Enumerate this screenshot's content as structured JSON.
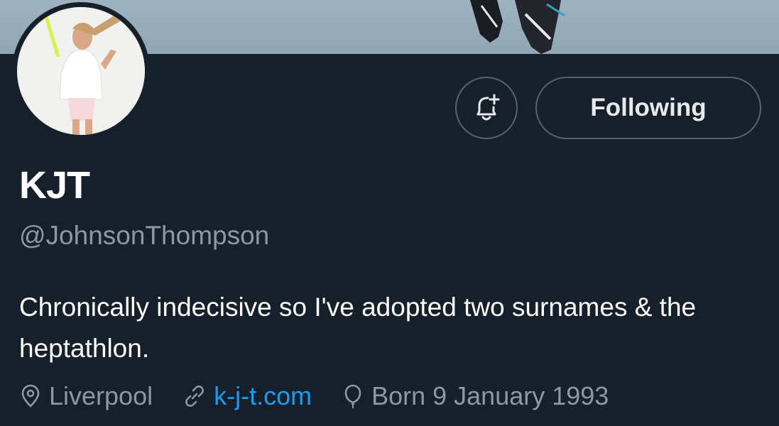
{
  "profile": {
    "display_name": "KJT",
    "handle": "@JohnsonThompson",
    "bio": "Chronically indecisive so I've adopted two surnames & the heptathlon.",
    "location": "Liverpool",
    "website": "k-j-t.com",
    "birthday": "Born 9 January 1993"
  },
  "actions": {
    "follow_label": "Following",
    "notify_icon": "bell-plus-icon"
  },
  "colors": {
    "background": "#15202b",
    "muted_text": "#8b98a5",
    "link": "#1d9bf0",
    "button_border": "#536471"
  }
}
